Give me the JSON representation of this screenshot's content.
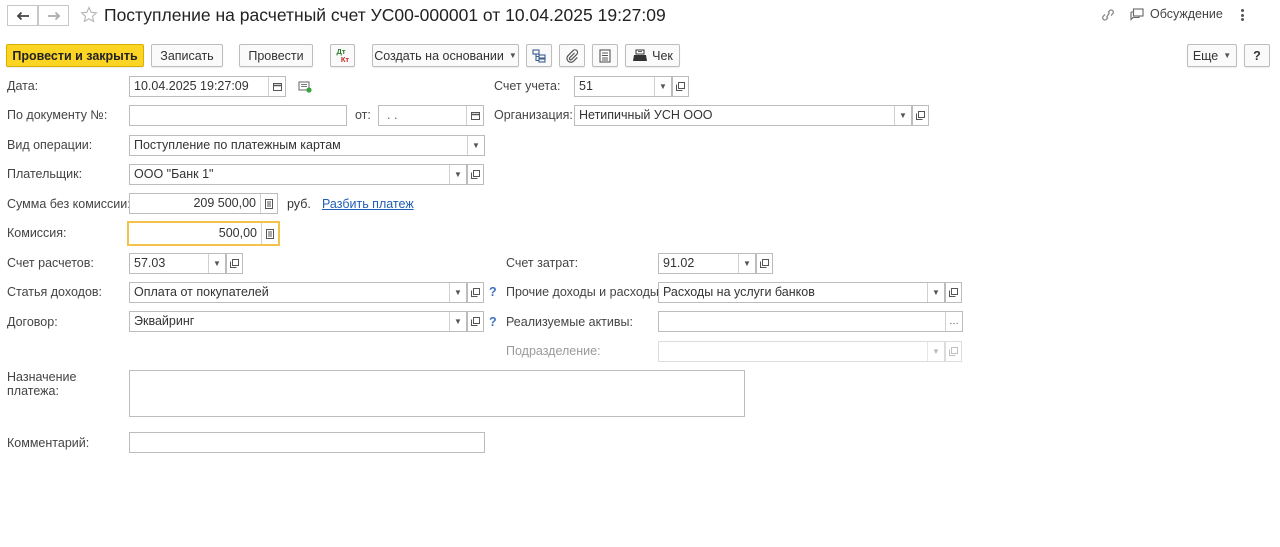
{
  "header": {
    "title": "Поступление на расчетный счет УС00-000001 от 10.04.2025 19:27:09",
    "discussion_label": "Обсуждение"
  },
  "toolbar": {
    "post_close": "Провести и закрыть",
    "save": "Записать",
    "post": "Провести",
    "dtkt_top": "Дт",
    "dtkt_bottom": "Кт",
    "create_based": "Создать на основании",
    "receipt": "Чек",
    "more": "Еще",
    "help": "?"
  },
  "form": {
    "date": {
      "label": "Дата:",
      "value": "10.04.2025 19:27:09"
    },
    "doc_number": {
      "label": "По документу №:",
      "value": ""
    },
    "doc_from": {
      "label": "от:",
      "value": " .  ."
    },
    "operation_type": {
      "label": "Вид операции:",
      "value": "Поступление по платежным картам"
    },
    "payer": {
      "label": "Плательщик:",
      "value": "ООО \"Банк 1\""
    },
    "amount": {
      "label": "Сумма без комиссии:",
      "value": "209 500,00",
      "currency": "руб.",
      "split_link": "Разбить платеж"
    },
    "commission": {
      "label": "Комиссия:",
      "value": "500,00"
    },
    "settlement_account": {
      "label": "Счет расчетов:",
      "value": "57.03"
    },
    "income_item": {
      "label": "Статья доходов:",
      "value": "Оплата от покупателей"
    },
    "contract": {
      "label": "Договор:",
      "value": "Эквайринг"
    },
    "purpose": {
      "label": "Назначение платежа:",
      "value": ""
    },
    "comment": {
      "label": "Комментарий:",
      "value": ""
    },
    "account": {
      "label": "Счет учета:",
      "value": "51"
    },
    "organization": {
      "label": "Организация:",
      "value": "Нетипичный УСН ООО"
    },
    "expense_account": {
      "label": "Счет затрат:",
      "value": "91.02"
    },
    "other_income_expense": {
      "label": "Прочие доходы и расходы:",
      "value": "Расходы на услуги банков"
    },
    "sold_assets": {
      "label": "Реализуемые активы:",
      "value": ""
    },
    "division": {
      "label": "Подразделение:",
      "value": ""
    }
  },
  "colors": {
    "primary_button": "#fbd424",
    "link": "#1f5fb4",
    "help": "#3b73c4",
    "focus": "#f2c24a"
  }
}
